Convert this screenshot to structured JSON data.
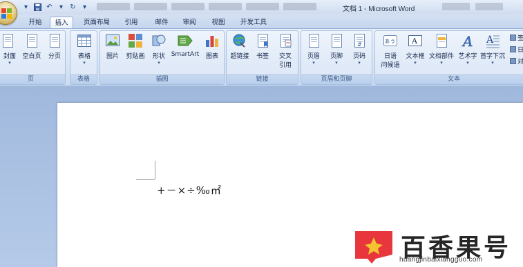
{
  "window": {
    "title": "文档 1 - Microsoft Word"
  },
  "tabs": [
    {
      "label": "开始",
      "active": false
    },
    {
      "label": "插入",
      "active": true
    },
    {
      "label": "页面布局",
      "active": false
    },
    {
      "label": "引用",
      "active": false
    },
    {
      "label": "邮件",
      "active": false
    },
    {
      "label": "审阅",
      "active": false
    },
    {
      "label": "视图",
      "active": false
    },
    {
      "label": "开发工具",
      "active": false
    }
  ],
  "ribbon": {
    "groups": {
      "pages": {
        "label": "页",
        "items": {
          "cover": "封面",
          "blank": "空白页",
          "break": "分页"
        }
      },
      "tables": {
        "label": "表格",
        "items": {
          "table": "表格"
        }
      },
      "illustrations": {
        "label": "插图",
        "items": {
          "picture": "图片",
          "clipart": "剪贴画",
          "shapes": "形状",
          "smartart": "SmartArt",
          "chart": "图表"
        }
      },
      "links": {
        "label": "链接",
        "items": {
          "hyperlink": "超链接",
          "bookmark": "书签",
          "crossref_1": "交叉",
          "crossref_2": "引用"
        }
      },
      "header_footer": {
        "label": "页眉和页脚",
        "items": {
          "header": "页眉",
          "footer": "页脚",
          "pagenum": "页码"
        }
      },
      "text": {
        "label": "文本",
        "items": {
          "phonetic_1": "日语",
          "phonetic_2": "问候语",
          "textbox": "文本框",
          "quickparts": "文档部件",
          "wordart": "艺术字",
          "dropcap": "首字下沉"
        },
        "overflow": [
          "签",
          "日",
          "对"
        ]
      }
    }
  },
  "document": {
    "body_text": "+－×÷‰㎡"
  },
  "watermark": {
    "brand": "百香果号",
    "url": "huangjinbaixiangguo.com",
    "colors": {
      "logo_red": "#e8363d",
      "star": "#f4c430"
    }
  },
  "colors": {
    "ribbon": "#dbe7f6",
    "tab_bar": "#c3d5ee",
    "document_background": "#a9c0e2",
    "page": "#ffffff"
  }
}
